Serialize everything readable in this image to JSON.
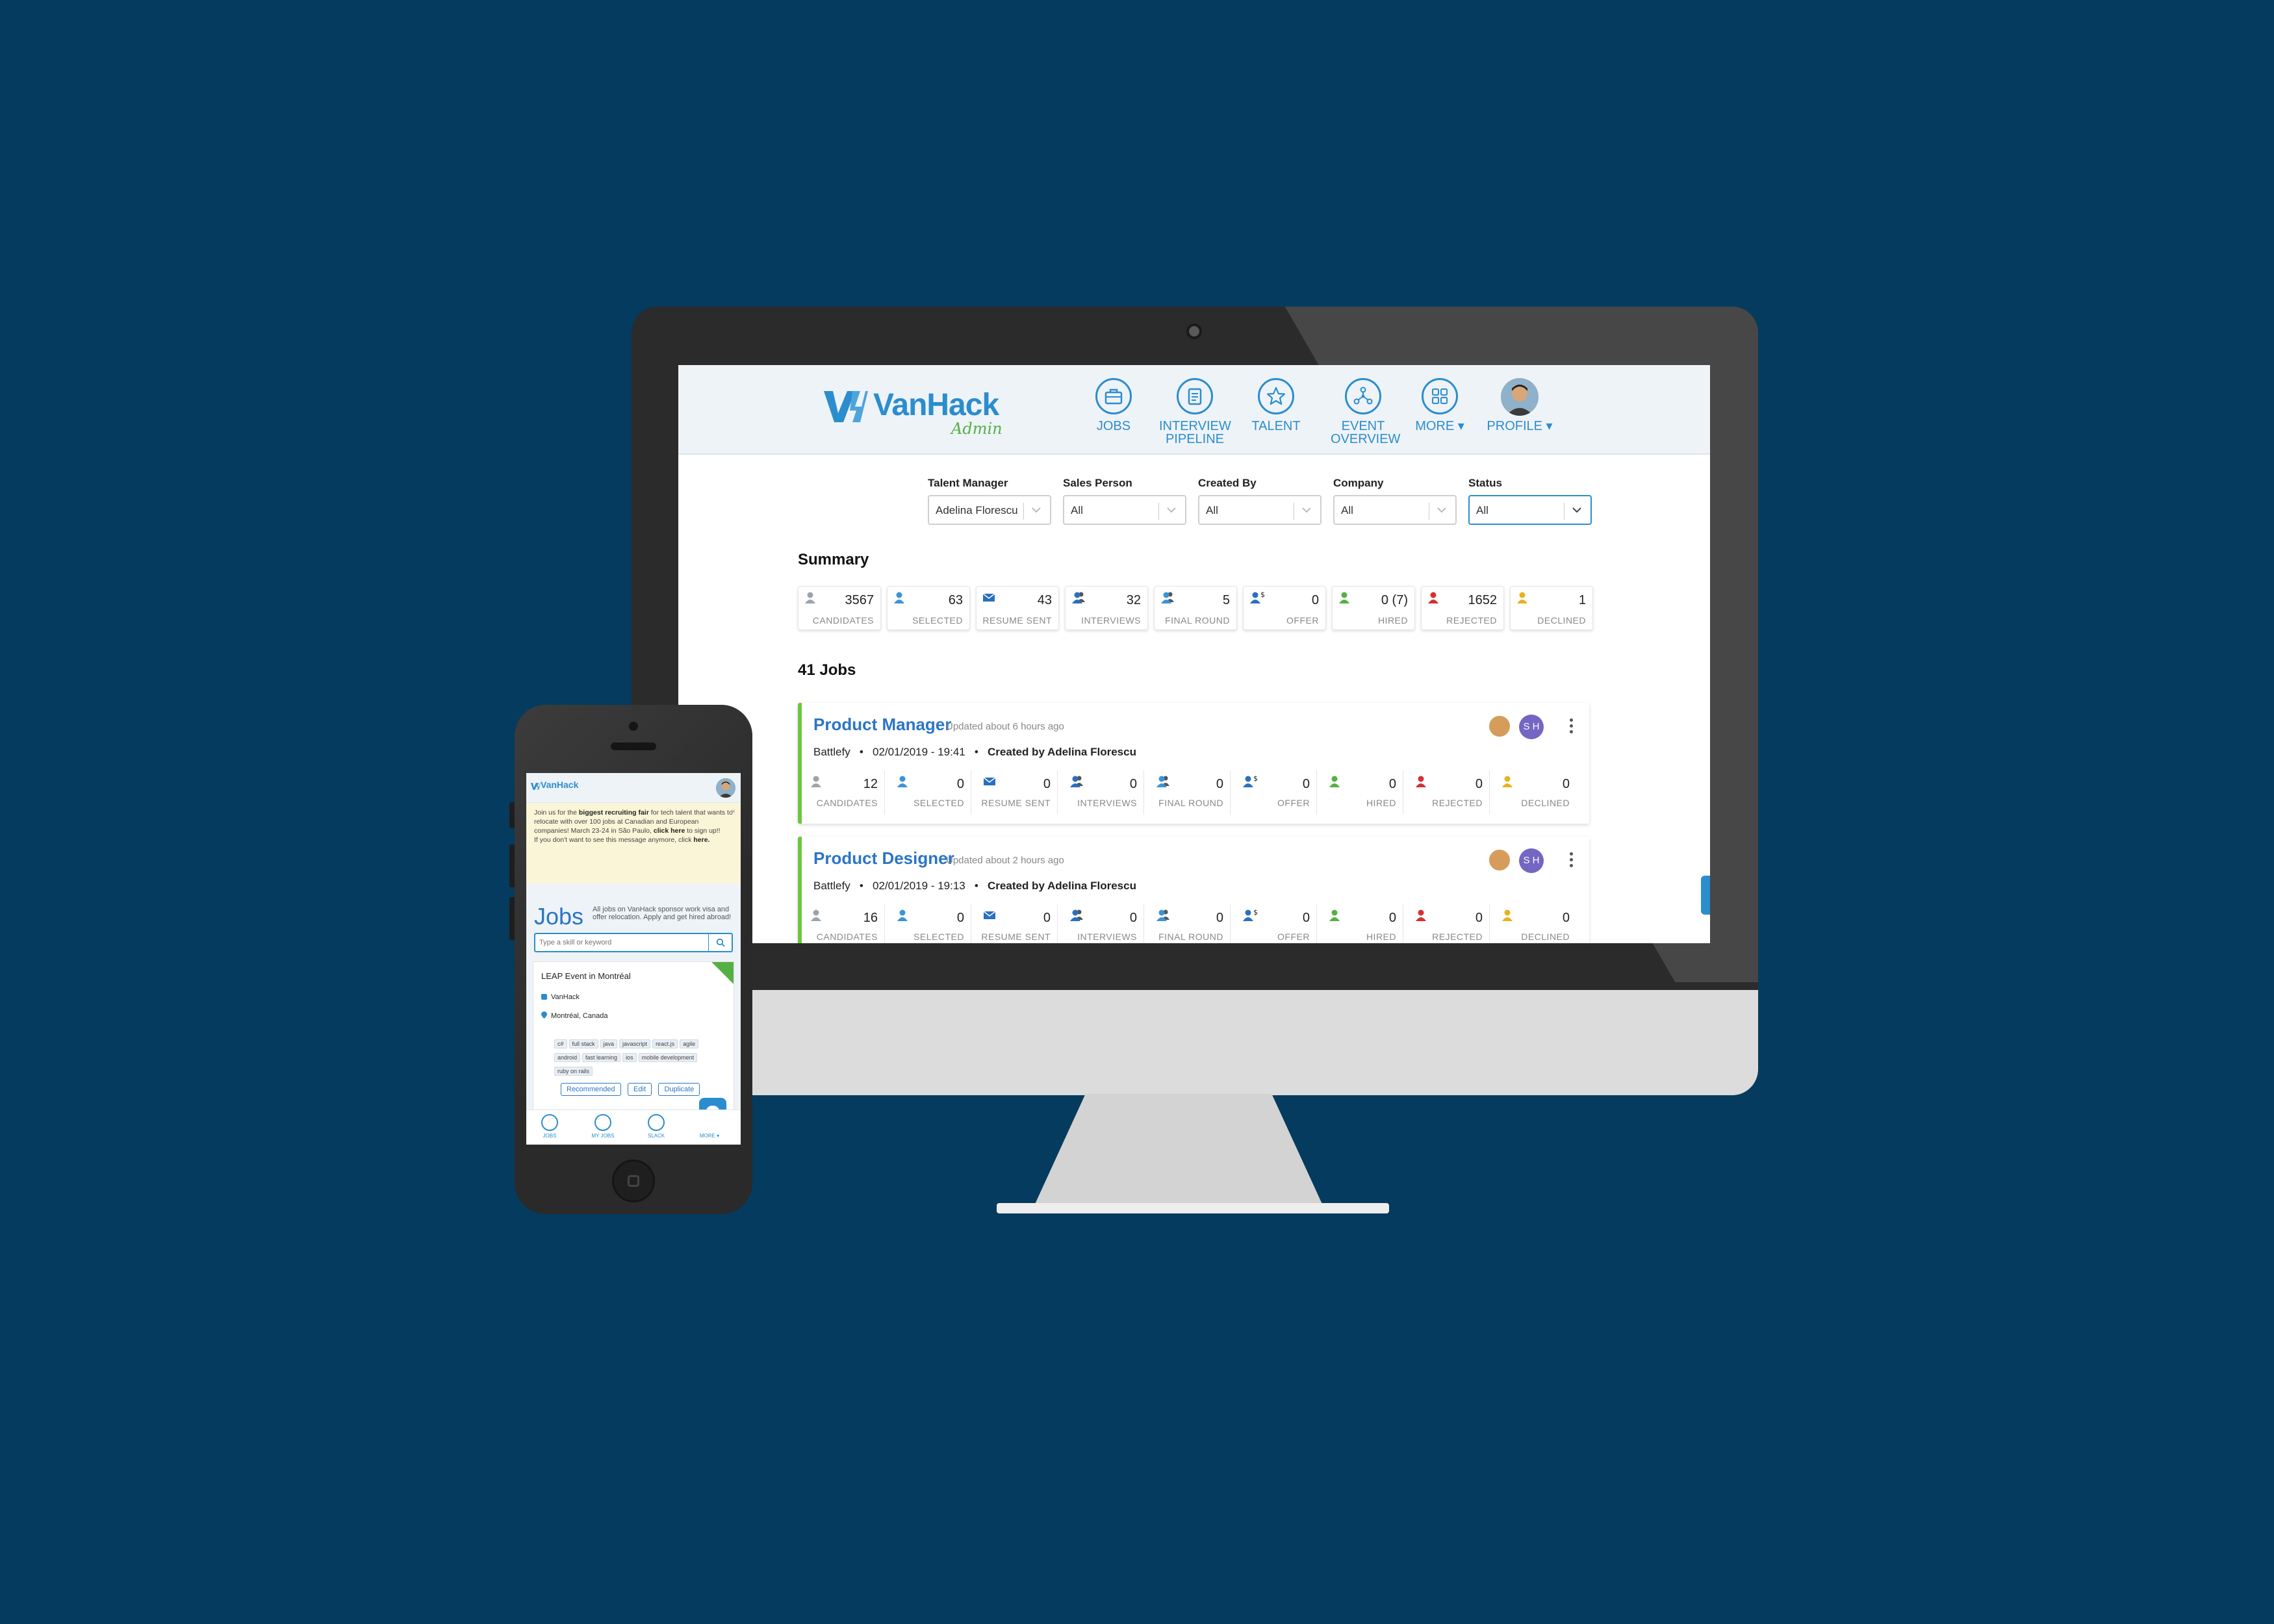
{
  "desktop": {
    "header": {
      "logo_word": "VanHack",
      "logo_sub": "Admin",
      "nav": [
        {
          "label1": "JOBS",
          "label2": "",
          "icon": "briefcase-icon"
        },
        {
          "label1": "INTERVIEW",
          "label2": "PIPELINE",
          "icon": "clipboard-icon"
        },
        {
          "label1": "TALENT",
          "label2": "",
          "icon": "star-icon"
        },
        {
          "label1": "EVENT",
          "label2": "OVERVIEW",
          "icon": "network-icon"
        },
        {
          "label1": "MORE ▾",
          "label2": "",
          "icon": "grid-icon"
        },
        {
          "label1": "PROFILE ▾",
          "label2": "",
          "icon": "avatar"
        }
      ]
    },
    "filters": [
      {
        "label": "Talent Manager",
        "value": "Adelina Florescu"
      },
      {
        "label": "Sales Person",
        "value": "All"
      },
      {
        "label": "Created By",
        "value": "All"
      },
      {
        "label": "Company",
        "value": "All"
      },
      {
        "label": "Status",
        "value": "All"
      }
    ],
    "summary_title": "Summary",
    "summary": [
      {
        "label": "CANDIDATES",
        "value": "3567",
        "color": "#9aa5ae"
      },
      {
        "label": "SELECTED",
        "value": "63",
        "color": "#3c93d6"
      },
      {
        "label": "RESUME SENT",
        "value": "43",
        "color": "#2b6fc0"
      },
      {
        "label": "INTERVIEWS",
        "value": "32",
        "color": "#2b6fc0"
      },
      {
        "label": "FINAL ROUND",
        "value": "5",
        "color": "#3c93d6"
      },
      {
        "label": "OFFER",
        "value": "0",
        "color": "#2b6fc0"
      },
      {
        "label": "HIRED",
        "value": "0 (7)",
        "color": "#55b043"
      },
      {
        "label": "REJECTED",
        "value": "1652",
        "color": "#d63031"
      },
      {
        "label": "DECLINED",
        "value": "1",
        "color": "#e6b31e"
      }
    ],
    "jobs_title": "41 Jobs",
    "jobs": [
      {
        "title": "Product Manager",
        "updated": "Updated about 6 hours ago",
        "company": "Battlefy",
        "date": "02/01/2019 - 19:41",
        "created_by": "Created by Adelina Florescu",
        "initials": "S H",
        "stats": [
          "12",
          "0",
          "0",
          "0",
          "0",
          "0",
          "0",
          "0",
          "0"
        ]
      },
      {
        "title": "Product Designer",
        "updated": "Updated about 2 hours ago",
        "company": "Battlefy",
        "date": "02/01/2019 - 19:13",
        "created_by": "Created by Adelina Florescu",
        "initials": "S H",
        "stats": [
          "16",
          "0",
          "0",
          "0",
          "0",
          "0",
          "0",
          "0",
          "0"
        ]
      }
    ]
  },
  "mobile": {
    "logo_word": "VanHack",
    "banner": {
      "line1": "Join us for the ",
      "bold1": "biggest recruiting fair",
      "line2": " for tech talent that wants to relocate with over 100 jobs at Canadian and European companies! March 23-24 in São Paulo, ",
      "bold2": "click here",
      "line3": " to sign up!!",
      "line4": "If you don't want to see this message anymore, click ",
      "bold3": "here."
    },
    "jobs_title": "Jobs",
    "jobs_desc": "All jobs on VanHack sponsor work visa and offer relocation. Apply and get hired abroad!",
    "search_placeholder": "Type a skill or keyword",
    "card": {
      "title": "LEAP Event in Montréal",
      "company": "VanHack",
      "location": "Montréal, Canada",
      "tags": [
        "c#",
        "full stack",
        "java",
        "javascript",
        "react.js",
        "agile",
        "android",
        "fast learning",
        "ios",
        "mobile development",
        "ruby on rails"
      ],
      "buttons": [
        "Recommended",
        "Edit",
        "Duplicate"
      ]
    },
    "tabs": [
      "JOBS",
      "MY JOBS",
      "SLACK",
      "MORE ▾"
    ]
  }
}
